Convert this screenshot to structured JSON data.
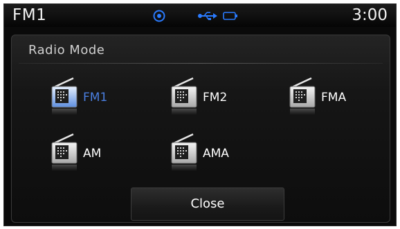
{
  "status_bar": {
    "mode": "FM1",
    "time": "3:00",
    "icons": [
      "navigation-icon",
      "usb-icon",
      "battery-icon"
    ]
  },
  "dialog": {
    "title": "Radio Mode",
    "options": [
      {
        "label": "FM1",
        "selected": true,
        "icon": "radio-icon"
      },
      {
        "label": "FM2",
        "selected": false,
        "icon": "radio-icon"
      },
      {
        "label": "FMA",
        "selected": false,
        "icon": "radio-icon"
      },
      {
        "label": "AM",
        "selected": false,
        "icon": "radio-icon"
      },
      {
        "label": "AMA",
        "selected": false,
        "icon": "radio-icon"
      }
    ],
    "close_label": "Close"
  },
  "colors": {
    "accent": "#4a7fe0",
    "status_icon": "#2a7bff",
    "text": "#ffffff",
    "background": "#0a0a0a"
  }
}
